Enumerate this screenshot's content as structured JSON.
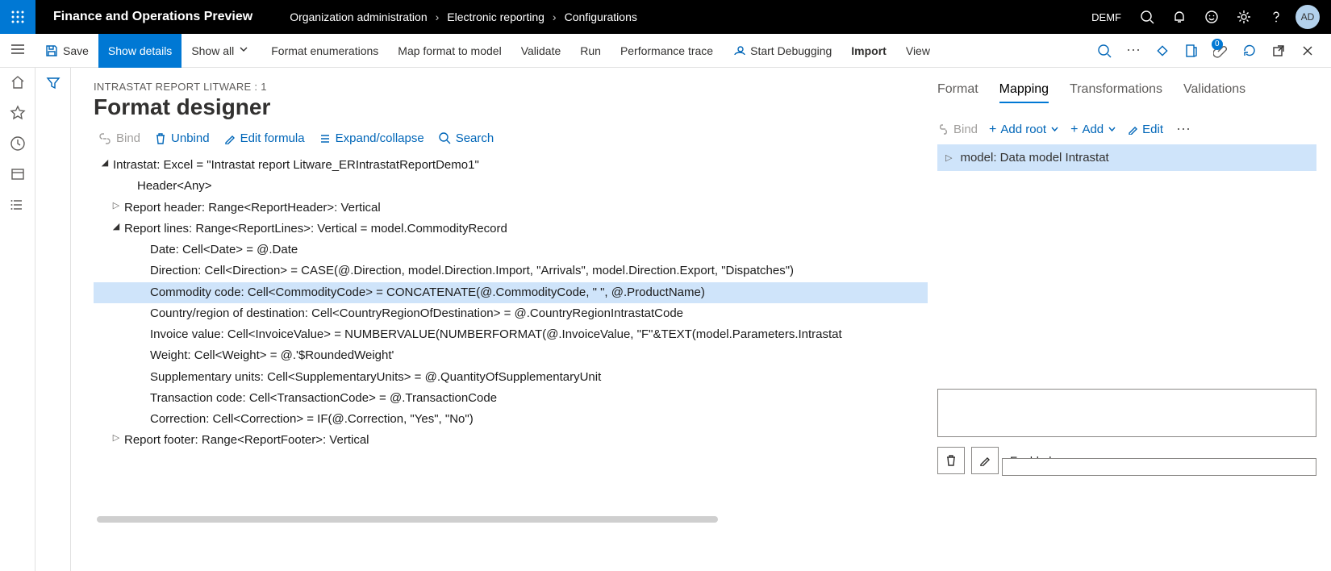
{
  "header": {
    "app_title": "Finance and Operations Preview",
    "breadcrumb": [
      "Organization administration",
      "Electronic reporting",
      "Configurations"
    ],
    "company": "DEMF",
    "avatar": "AD"
  },
  "commands": {
    "save": "Save",
    "show_details": "Show details",
    "show_all": "Show all",
    "format_enum": "Format enumerations",
    "map_format": "Map format to model",
    "validate": "Validate",
    "run": "Run",
    "perf": "Performance trace",
    "start_debug": "Start Debugging",
    "import": "Import",
    "view": "View",
    "badge": "0"
  },
  "page": {
    "crumb": "INTRASTAT REPORT LITWARE : 1",
    "title": "Format designer"
  },
  "toolbar": {
    "bind": "Bind",
    "unbind": "Unbind",
    "edit_formula": "Edit formula",
    "expand": "Expand/collapse",
    "search": "Search"
  },
  "tree": {
    "root": "Intrastat: Excel = \"Intrastat report Litware_ERIntrastatReportDemo1\"",
    "header_any": "Header<Any>",
    "report_header": "Report header: Range<ReportHeader>: Vertical",
    "report_lines": "Report lines: Range<ReportLines>: Vertical = model.CommodityRecord",
    "lines": {
      "date": "Date: Cell<Date> = @.Date",
      "direction": "Direction: Cell<Direction> = CASE(@.Direction, model.Direction.Import, \"Arrivals\", model.Direction.Export, \"Dispatches\")",
      "commodity": "Commodity code: Cell<CommodityCode> = CONCATENATE(@.CommodityCode, \" \", @.ProductName)",
      "country": "Country/region of destination: Cell<CountryRegionOfDestination> = @.CountryRegionIntrastatCode",
      "invoice": "Invoice value: Cell<InvoiceValue> = NUMBERVALUE(NUMBERFORMAT(@.InvoiceValue, \"F\"&TEXT(model.Parameters.Intrastat",
      "weight": "Weight: Cell<Weight> = @.'$RoundedWeight'",
      "supp": "Supplementary units: Cell<SupplementaryUnits> = @.QuantityOfSupplementaryUnit",
      "trans": "Transaction code: Cell<TransactionCode> = @.TransactionCode",
      "corr": "Correction: Cell<Correction> = IF(@.Correction, \"Yes\", \"No\")"
    },
    "report_footer": "Report footer: Range<ReportFooter>: Vertical"
  },
  "right": {
    "tabs": {
      "format": "Format",
      "mapping": "Mapping",
      "transformations": "Transformations",
      "validations": "Validations"
    },
    "toolbar": {
      "bind": "Bind",
      "add_root": "Add root",
      "add": "Add",
      "edit": "Edit"
    },
    "node": "model: Data model Intrastat",
    "enabled_label": "Enabled"
  }
}
